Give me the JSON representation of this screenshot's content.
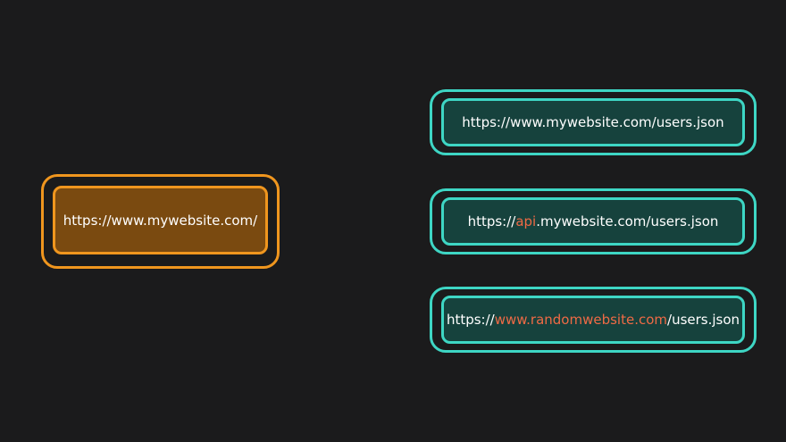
{
  "colors": {
    "background": "#1b1b1c",
    "source_border": "#f0961e",
    "source_fill": "#7a4a10",
    "target_border": "#3ed6c4",
    "target_fill": "#16423d",
    "highlight_text": "#ef6a45"
  },
  "source": {
    "url": "https://www.mywebsite.com/"
  },
  "targets": [
    {
      "before": "https://www.mywebsite.com/users.json",
      "highlight": "",
      "after": ""
    },
    {
      "before": "https://",
      "highlight": "api",
      "after": ".mywebsite.com/users.json"
    },
    {
      "before": "https://",
      "highlight": "www.randomwebsite.com",
      "after": "/users.json"
    }
  ]
}
